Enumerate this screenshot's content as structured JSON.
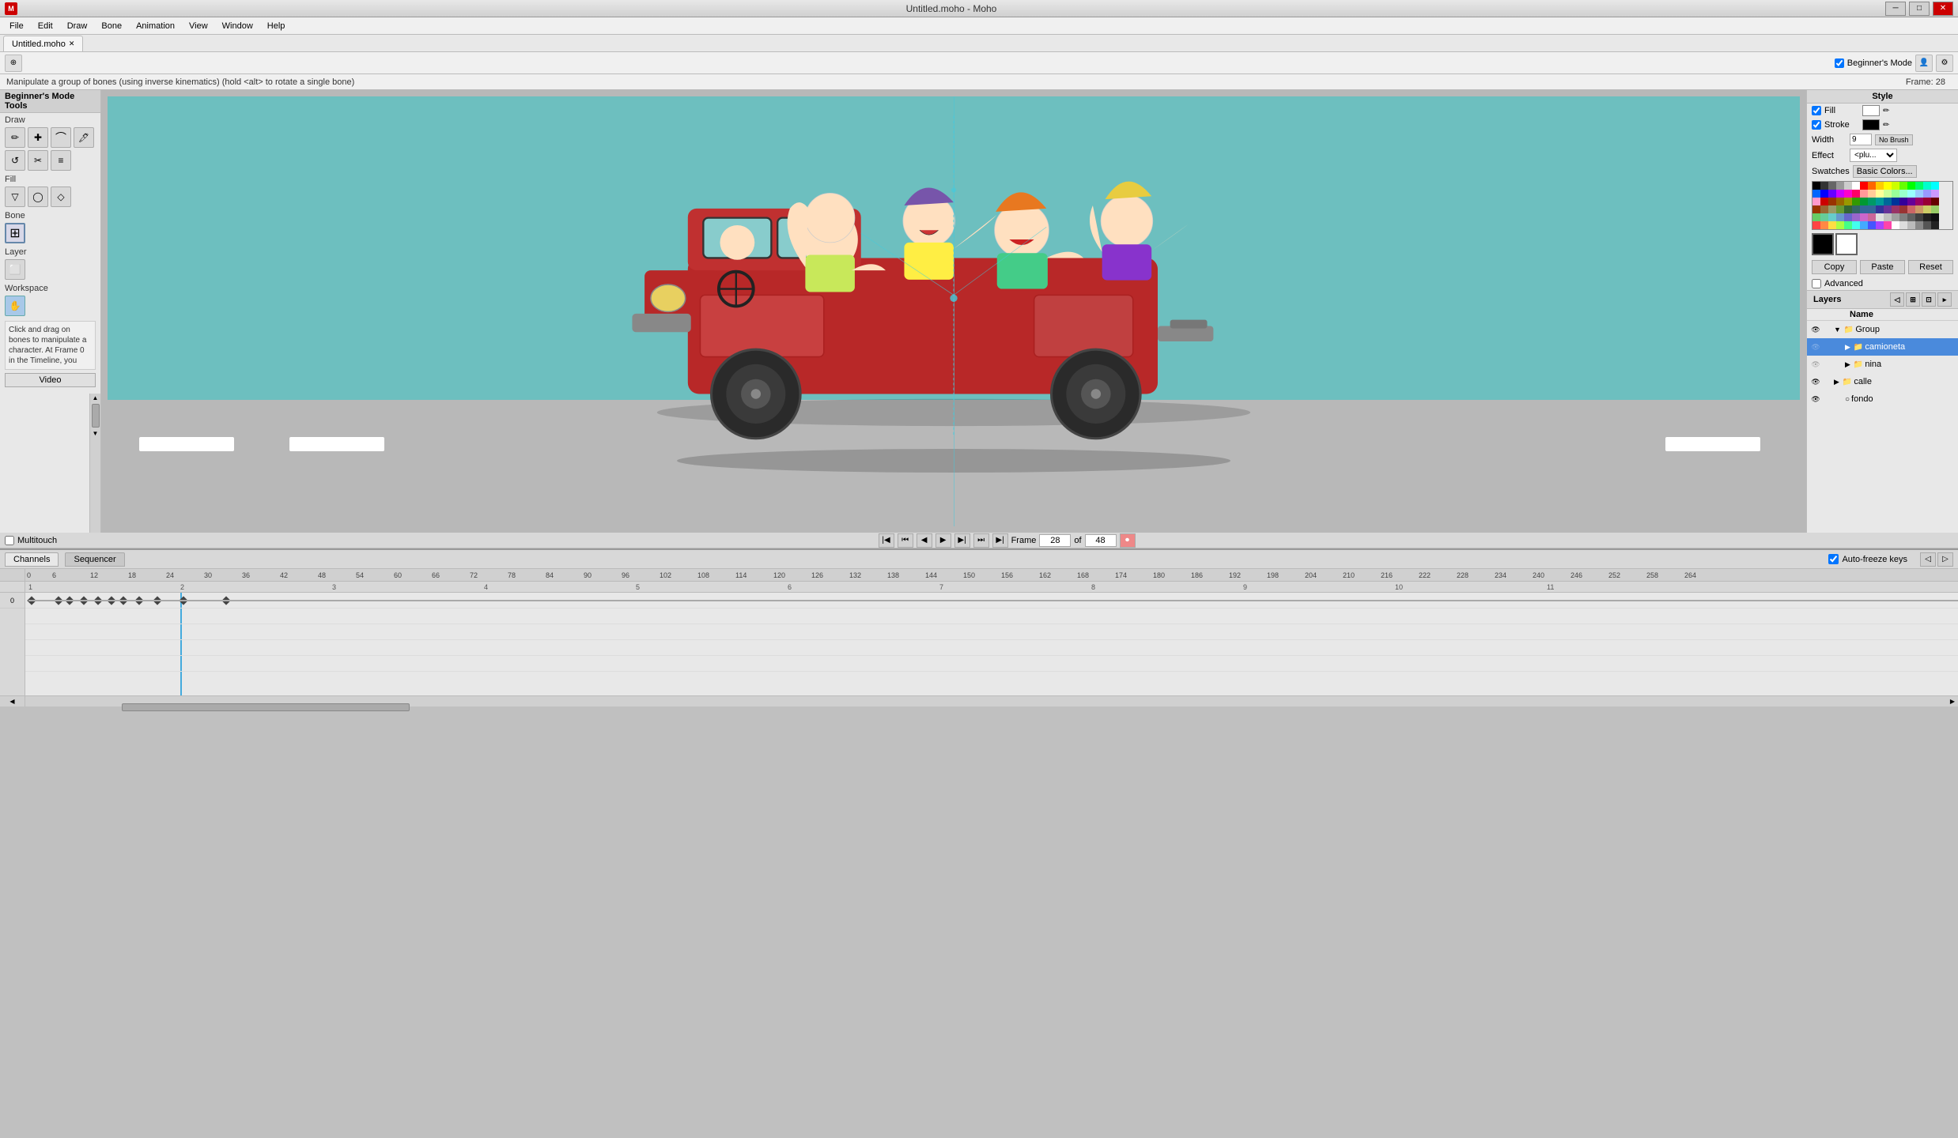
{
  "window": {
    "title": "Untitled.moho - Moho",
    "tab": "Untitled.moho",
    "frame_label": "Frame: 28"
  },
  "menu": {
    "items": [
      "File",
      "Edit",
      "Draw",
      "Bone",
      "Animation",
      "View",
      "Window",
      "Help"
    ]
  },
  "toolbar": {
    "icon": "⊕",
    "beginner_mode_label": "Beginner's Mode",
    "frame_indicator": "Frame: 28"
  },
  "statusbar": {
    "text": "Manipulate a group of bones (using inverse kinematics) (hold <alt> to rotate a single bone)"
  },
  "tools": {
    "header": "Beginner's Mode Tools",
    "sections": {
      "draw_label": "Draw",
      "fill_label": "Fill",
      "bone_label": "Bone",
      "layer_label": "Layer",
      "workspace_label": "Workspace"
    },
    "draw_tools": [
      "✏️",
      "✚",
      "↩",
      "🖊",
      "⟳",
      "✂",
      "☰"
    ],
    "fill_tools": [
      "▽",
      "◯",
      "◇"
    ],
    "bone_tools": [
      "🦴"
    ],
    "layer_tools": [
      "⬜"
    ],
    "workspace_tools": [
      "✋"
    ]
  },
  "workspace_desc": {
    "text": "Click and drag on bones to manipulate a character. At Frame 0 in the Timeline, you",
    "video_btn": "Video"
  },
  "style_panel": {
    "header": "Style",
    "fill_label": "Fill",
    "fill_checked": true,
    "fill_color": "#ffffff",
    "stroke_label": "Stroke",
    "stroke_checked": true,
    "stroke_color": "#000000",
    "width_label": "Width",
    "width_value": "9",
    "no_brush_btn": "No Brush",
    "effect_label": "Effect",
    "effect_value": "<plu...",
    "swatches_label": "Swatches",
    "swatches_picker": "Basic Colors...",
    "copy_btn": "Copy",
    "paste_btn": "Paste",
    "reset_btn": "Reset",
    "advanced_label": "Advanced",
    "advanced_checked": false
  },
  "color_grid": [
    [
      "#000000",
      "#333333",
      "#666666",
      "#999999",
      "#cccccc",
      "#ffffff",
      "#ff0000",
      "#ff6600",
      "#ffcc00",
      "#ffff00",
      "#ccff00",
      "#66ff00",
      "#00ff00",
      "#00ff66",
      "#00ffcc",
      "#00ffff"
    ],
    [
      "#0066ff",
      "#0000ff",
      "#6600ff",
      "#cc00ff",
      "#ff00cc",
      "#ff0066",
      "#ff9999",
      "#ffcc99",
      "#ffff99",
      "#ccff99",
      "#99ff99",
      "#99ffcc",
      "#99ffff",
      "#99ccff",
      "#9999ff",
      "#cc99ff"
    ],
    [
      "#ff99cc",
      "#cc0000",
      "#993300",
      "#996600",
      "#999900",
      "#339900",
      "#009933",
      "#009966",
      "#009999",
      "#006699",
      "#003399",
      "#330099",
      "#660099",
      "#990066",
      "#990033",
      "#660000"
    ],
    [
      "#993300",
      "#996633",
      "#999966",
      "#669933",
      "#336633",
      "#336666",
      "#336699",
      "#336699",
      "#333399",
      "#663399",
      "#993366",
      "#993333",
      "#cc6666",
      "#cc9966",
      "#cccc66",
      "#99cc66"
    ],
    [
      "#66cc66",
      "#66cc99",
      "#66cccc",
      "#6699cc",
      "#6666cc",
      "#9966cc",
      "#cc66cc",
      "#cc6699",
      "#e0e0e0",
      "#c0c0c0",
      "#a0a0a0",
      "#808080",
      "#606060",
      "#404040",
      "#202020",
      "#101010"
    ],
    [
      "#ff4444",
      "#ff8844",
      "#ffdd44",
      "#aaff44",
      "#44ff88",
      "#44ffee",
      "#44aaff",
      "#4455ff",
      "#aa44ff",
      "#ff44aa",
      "#ffffff",
      "#dddddd",
      "#bbbbbb",
      "#888888",
      "#555555",
      "#222222"
    ]
  ],
  "big_swatches": {
    "primary": "#000000",
    "secondary": "#ffffff"
  },
  "layers": {
    "header": "Layers",
    "name_col": "Name",
    "items": [
      {
        "name": "Group",
        "type": "group",
        "level": 0,
        "expanded": true,
        "visible": true,
        "locked": false
      },
      {
        "name": "camioneta",
        "type": "group",
        "level": 1,
        "expanded": false,
        "visible": false,
        "locked": false,
        "active": true
      },
      {
        "name": "nina",
        "type": "group",
        "level": 1,
        "expanded": false,
        "visible": false,
        "locked": false
      },
      {
        "name": "calle",
        "type": "group",
        "level": 0,
        "expanded": false,
        "visible": true,
        "locked": false
      },
      {
        "name": "fondo",
        "type": "object",
        "level": 0,
        "expanded": false,
        "visible": true,
        "locked": false
      }
    ]
  },
  "timeline": {
    "channels_tab": "Channels",
    "sequencer_tab": "Sequencer",
    "autofreeze_label": "Auto-freeze keys",
    "autofreeze_checked": true,
    "multitouch_label": "Multitouch",
    "multitouch_checked": false,
    "frame_label": "Frame",
    "frame_value": "28",
    "total_frames": "48",
    "frame_numbers": [
      0,
      6,
      12,
      18,
      24,
      30,
      36,
      42,
      48,
      54,
      60,
      66,
      72,
      78,
      84,
      90,
      96,
      102,
      108,
      114,
      120,
      126,
      132,
      138,
      144,
      150,
      156,
      162,
      168,
      174,
      180,
      186,
      192,
      198,
      204,
      210,
      216,
      222,
      228,
      234,
      240,
      246,
      252,
      258,
      264
    ],
    "ruler_numbers": [
      1,
      2,
      3,
      4,
      5,
      6,
      7,
      8,
      9,
      10,
      11
    ],
    "play_btn": "▶",
    "stop_btn": "■",
    "prev_frame_btn": "◀",
    "next_frame_btn": "▶",
    "prev_keyframe_btn": "⏮",
    "next_keyframe_btn": "⏭",
    "record_btn": "⏺"
  },
  "canvas": {
    "bg_color": "#7dc8c8",
    "road_color": "#b8b8b8"
  }
}
